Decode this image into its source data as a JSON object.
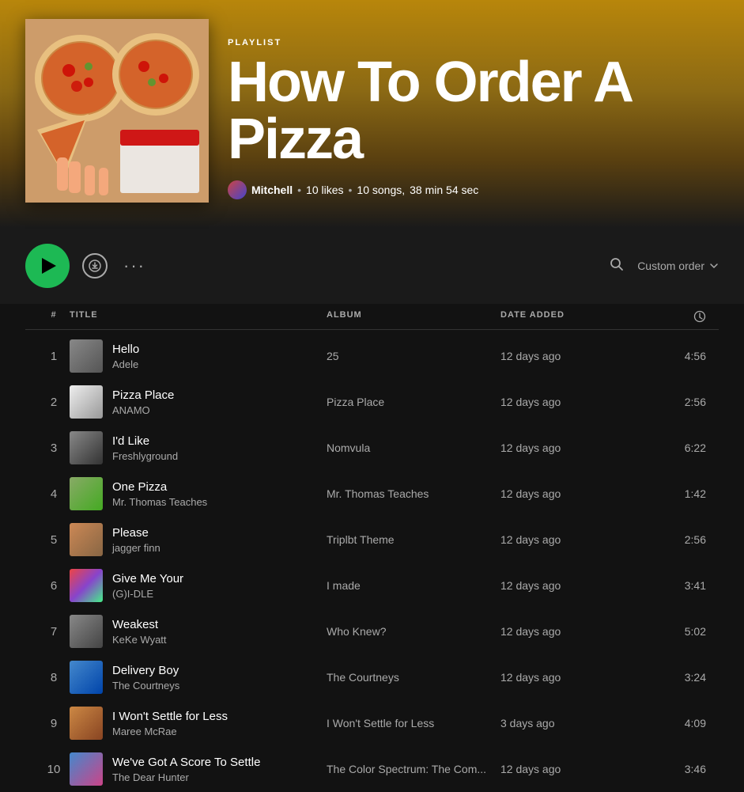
{
  "hero": {
    "type_label": "PLAYLIST",
    "title": "How To Order A Pizza",
    "meta_author": "Mitchell",
    "meta_likes": "10 likes",
    "meta_songs": "10 songs,",
    "meta_duration": "38 min 54 sec"
  },
  "controls": {
    "play_label": "Play",
    "download_label": "Download",
    "more_label": "More options",
    "search_label": "Search",
    "custom_order_label": "Custom order"
  },
  "table": {
    "headers": {
      "num": "#",
      "title": "TITLE",
      "album": "ALBUM",
      "date": "DATE ADDED",
      "duration": "⏱"
    }
  },
  "tracks": [
    {
      "num": "1",
      "name": "Hello",
      "artist": "Adele",
      "album": "25",
      "date": "12 days ago",
      "duration": "4:56",
      "thumb_class": "thumb-1"
    },
    {
      "num": "2",
      "name": "Pizza Place",
      "artist": "ANAMO",
      "album": "Pizza Place",
      "date": "12 days ago",
      "duration": "2:56",
      "thumb_class": "thumb-2"
    },
    {
      "num": "3",
      "name": "I'd Like",
      "artist": "Freshlyground",
      "album": "Nomvula",
      "date": "12 days ago",
      "duration": "6:22",
      "thumb_class": "thumb-3"
    },
    {
      "num": "4",
      "name": "One Pizza",
      "artist": "Mr. Thomas Teaches",
      "album": "Mr. Thomas Teaches",
      "date": "12 days ago",
      "duration": "1:42",
      "thumb_class": "thumb-4"
    },
    {
      "num": "5",
      "name": "Please",
      "artist": "jagger finn",
      "album": "Triplbt Theme",
      "date": "12 days ago",
      "duration": "2:56",
      "thumb_class": "thumb-5"
    },
    {
      "num": "6",
      "name": "Give Me Your",
      "artist": "(G)I-DLE",
      "album": "I made",
      "date": "12 days ago",
      "duration": "3:41",
      "thumb_class": "thumb-6"
    },
    {
      "num": "7",
      "name": "Weakest",
      "artist": "KeKe Wyatt",
      "album": "Who Knew?",
      "date": "12 days ago",
      "duration": "5:02",
      "thumb_class": "thumb-7"
    },
    {
      "num": "8",
      "name": "Delivery Boy",
      "artist": "The Courtneys",
      "album": "The Courtneys",
      "date": "12 days ago",
      "duration": "3:24",
      "thumb_class": "thumb-8"
    },
    {
      "num": "9",
      "name": "I Won't Settle for Less",
      "artist": "Maree McRae",
      "album": "I Won't Settle for Less",
      "date": "3 days ago",
      "duration": "4:09",
      "thumb_class": "thumb-9"
    },
    {
      "num": "10",
      "name": "We've Got A Score To Settle",
      "artist": "The Dear Hunter",
      "album": "The Color Spectrum: The Com...",
      "date": "12 days ago",
      "duration": "3:46",
      "thumb_class": "thumb-10"
    }
  ]
}
